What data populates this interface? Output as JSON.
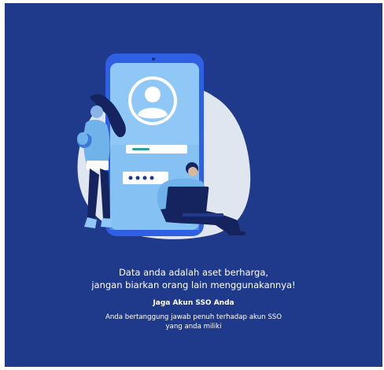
{
  "colors": {
    "background": "#1f3a8a",
    "blob": "#dfe6ef",
    "phone_frame": "#2f5fe3",
    "phone_screen": "#8fc8f7",
    "accent": "#0b4fd8"
  },
  "illustration": {
    "icons": [
      "user-avatar-icon",
      "password-dots-icon"
    ]
  },
  "message": {
    "line1": "Data anda adalah aset berharga,",
    "line2": "jangan biarkan orang lain menggunakannya!",
    "subtitle": "Jaga Akun SSO Anda",
    "desc_line1": "Anda bertanggung jawab penuh terhadap akun SSO",
    "desc_line2": "yang anda miliki"
  }
}
